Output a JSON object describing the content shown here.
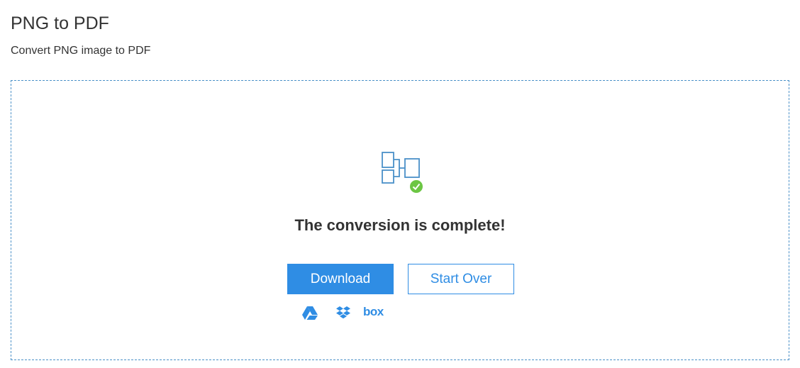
{
  "header": {
    "title": "PNG to PDF",
    "subtitle": "Convert PNG image to PDF"
  },
  "result": {
    "icon": "converted-files-icon",
    "status_icon": "check-icon",
    "status_text": "The conversion is complete!"
  },
  "actions": {
    "download_label": "Download",
    "start_over_label": "Start Over"
  },
  "cloud_services": {
    "google_drive_icon": "google-drive-icon",
    "dropbox_icon": "dropbox-icon",
    "box_label": "box"
  },
  "colors": {
    "accent": "#2f8de4",
    "success": "#6cc644",
    "text": "#333333",
    "border": "#4a90c8"
  }
}
